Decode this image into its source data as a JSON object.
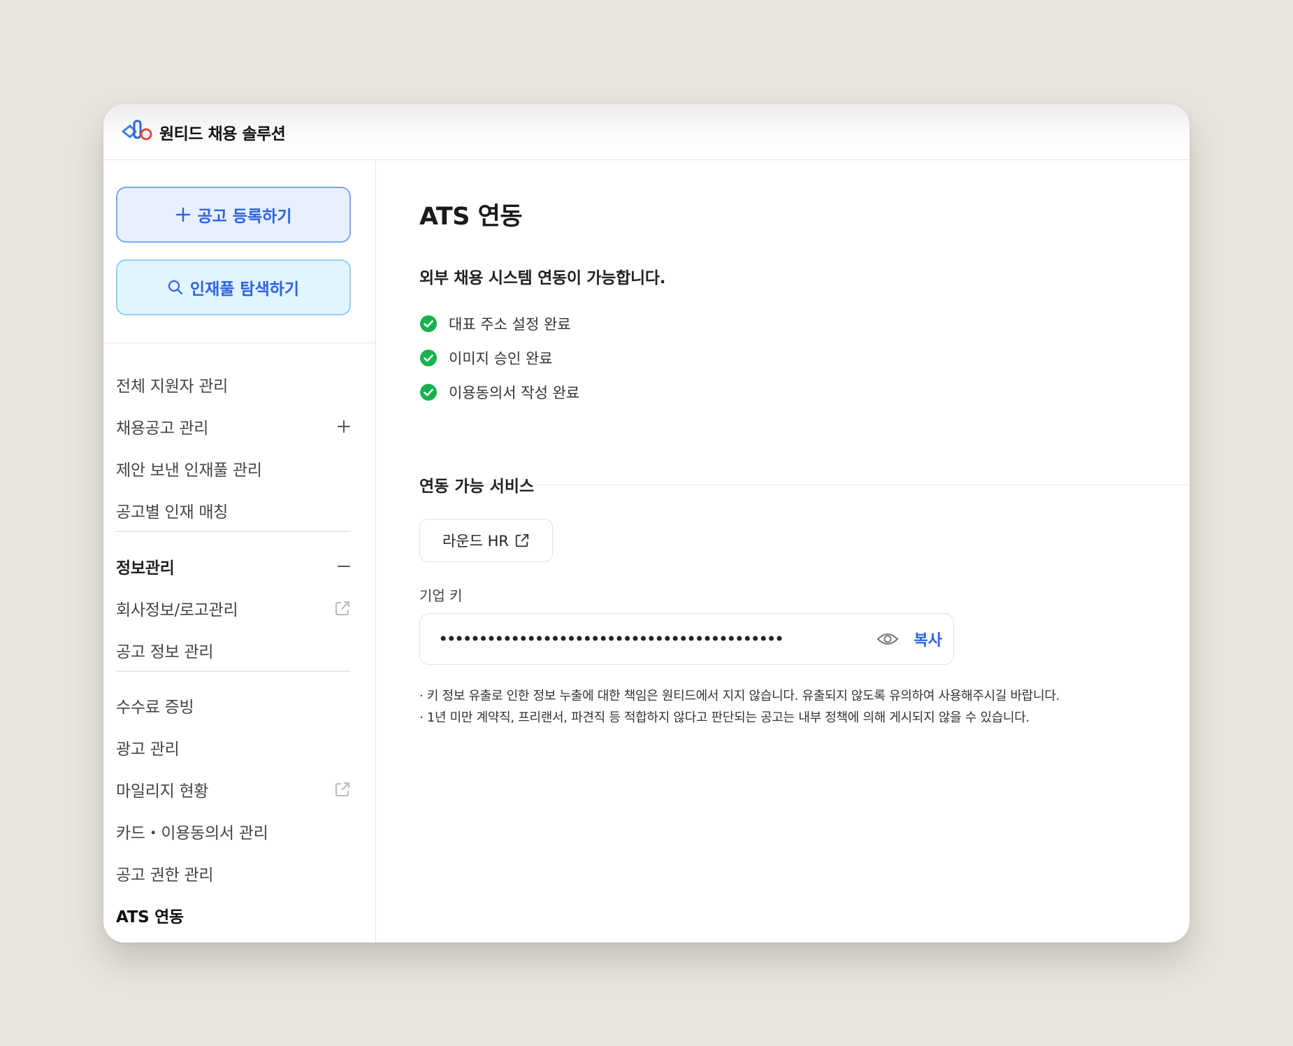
{
  "header": {
    "brand": "원티드 채용 솔루션",
    "logo_icon": "wanted-logo-icon"
  },
  "sidebar": {
    "cta_post_label": "공고 등록하기",
    "cta_search_label": "인재풀 탐색하기",
    "group1": [
      {
        "label": "전체 지원자 관리"
      },
      {
        "label": "채용공고 관리",
        "trail": "+"
      },
      {
        "label": "제안 보낸 인재풀 관리"
      },
      {
        "label": "공고별 인재 매칭"
      }
    ],
    "group2": {
      "head": "정보관리",
      "head_trail": "—",
      "items": [
        {
          "label": "회사정보/로고관리",
          "icon": "external-link-icon"
        },
        {
          "label": "공고 정보 관리"
        }
      ]
    },
    "group3": [
      {
        "label": "수수료 증빙"
      },
      {
        "label": "광고 관리"
      },
      {
        "label": "마일리지 현황",
        "icon": "external-link-icon"
      },
      {
        "label": "카드・이용동의서 관리"
      },
      {
        "label": "공고 권한 관리"
      },
      {
        "label": "ATS 연동",
        "active": true
      }
    ]
  },
  "main": {
    "title": "ATS 연동",
    "subtitle": "외부 채용 시스템 연동이 가능합니다.",
    "checks": [
      "대표 주소 설정 완료",
      "이미지 승인 완료",
      "이용동의서 작성 완료"
    ],
    "service_title": "연동 가능 서비스",
    "service_button": "라운드 HR",
    "key_label": "기업 키",
    "key_value": "•••••••••••••••••••••••••••••••••••••••••••",
    "copy_label": "복사",
    "notes": [
      "· 키 정보 유출로 인한 정보 누출에 대한 책임은 원티드에서 지지 않습니다. 유출되지 않도록 유의하여 사용해주시길 바랍니다.",
      "· 1년 미만 계약직, 프리랜서, 파견직 등 적합하지 않다고 판단되는 공고는 내부 정책에 의해 게시되지 않을 수 있습니다."
    ]
  },
  "colors": {
    "accent": "#2c63e0",
    "check_green": "#17b24d",
    "background": "#e8e5dc"
  }
}
